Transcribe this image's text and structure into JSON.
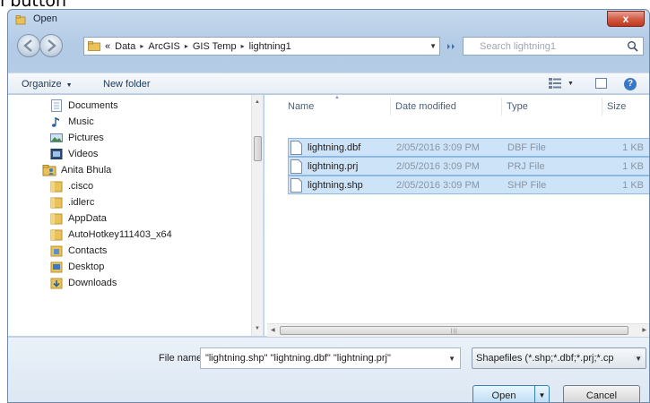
{
  "caption": "l button",
  "window": {
    "title": "Open",
    "close_label": "x"
  },
  "address": {
    "prefix": "«",
    "crumbs": [
      "Data",
      "ArcGIS",
      "GIS Temp",
      "lightning1"
    ],
    "separator": "▸"
  },
  "search": {
    "placeholder": "Search lightning1"
  },
  "toolbar": {
    "organize_label": "Organize",
    "new_folder_label": "New folder",
    "dropdown_glyph": "▼",
    "help_glyph": "?"
  },
  "tree": [
    {
      "label": "Documents",
      "icon": "documents-icon"
    },
    {
      "label": "Music",
      "icon": "music-icon"
    },
    {
      "label": "Pictures",
      "icon": "pictures-icon"
    },
    {
      "label": "Videos",
      "icon": "videos-icon"
    },
    {
      "label": "Anita Bhula",
      "icon": "user-folder-icon"
    },
    {
      "label": ".cisco",
      "icon": "folder-icon"
    },
    {
      "label": ".idlerc",
      "icon": "folder-icon"
    },
    {
      "label": "AppData",
      "icon": "folder-icon"
    },
    {
      "label": "AutoHotkey111403_x64",
      "icon": "folder-icon"
    },
    {
      "label": "Contacts",
      "icon": "contacts-icon"
    },
    {
      "label": "Desktop",
      "icon": "desktop-icon"
    },
    {
      "label": "Downloads",
      "icon": "downloads-icon"
    }
  ],
  "columns": {
    "name": "Name",
    "date": "Date modified",
    "type": "Type",
    "size": "Size"
  },
  "files": [
    {
      "name": "lightning.dbf",
      "date": "2/05/2016 3:09 PM",
      "type": "DBF File",
      "size": "1 KB"
    },
    {
      "name": "lightning.prj",
      "date": "2/05/2016 3:09 PM",
      "type": "PRJ File",
      "size": "1 KB"
    },
    {
      "name": "lightning.shp",
      "date": "2/05/2016 3:09 PM",
      "type": "SHP File",
      "size": "1 KB"
    }
  ],
  "footer": {
    "file_name_label": "File name:",
    "file_name_value": "\"lightning.shp\" \"lightning.dbf\" \"lightning.prj\"",
    "file_type_value": "Shapefiles (*.shp;*.dbf;*.prj;*.cp",
    "open_label": "Open",
    "cancel_label": "Cancel"
  },
  "colors": {
    "selection": "#cde3f8",
    "selection_border": "#8fb8e3",
    "folder": "#e9c25a",
    "accent": "#3a78c7"
  }
}
